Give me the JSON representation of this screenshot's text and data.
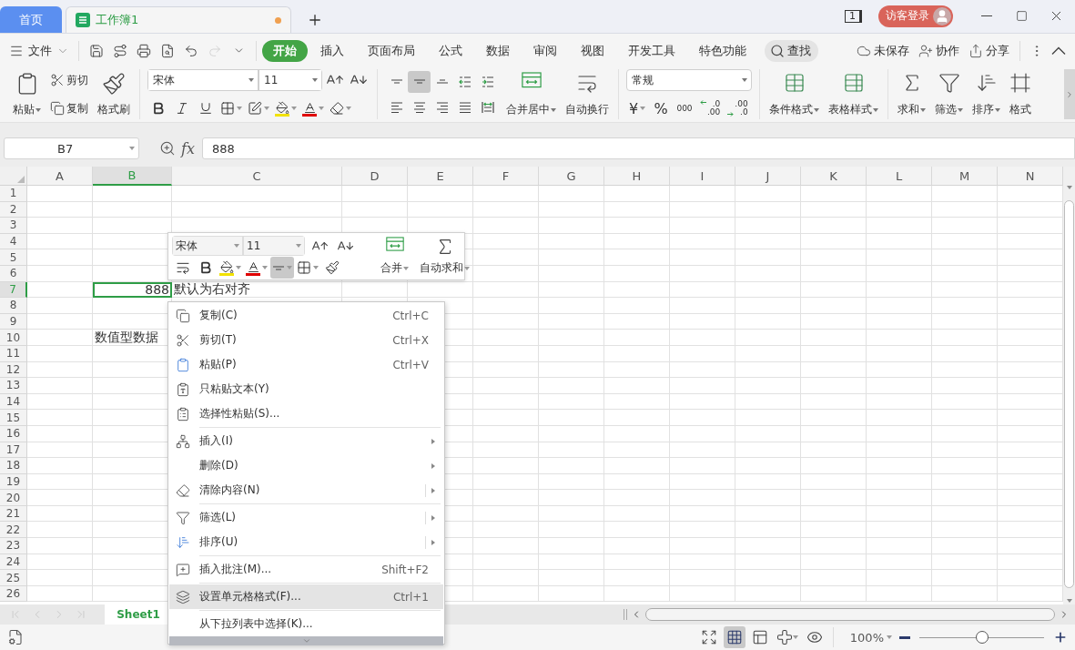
{
  "title_bar": {
    "tabs": [
      {
        "label": "首页",
        "kind": "home",
        "selected": false
      },
      {
        "label": "工作簿1",
        "kind": "sheet",
        "selected": true,
        "modified": true
      }
    ],
    "page_count": "1",
    "login": "访客登录"
  },
  "menu_bar": {
    "file": "文件",
    "quick_access": [
      {
        "kind": "save",
        "disabled": false
      },
      {
        "kind": "route",
        "disabled": false
      },
      {
        "kind": "print",
        "disabled": false
      },
      {
        "kind": "preview",
        "disabled": false
      },
      {
        "kind": "undo",
        "disabled": false
      },
      {
        "kind": "redo",
        "disabled": true
      },
      {
        "kind": "more",
        "disabled": false
      }
    ],
    "tabs": [
      {
        "label": "开始",
        "selected": true
      },
      {
        "label": "插入",
        "selected": false
      },
      {
        "label": "页面布局",
        "selected": false
      },
      {
        "label": "公式",
        "selected": false
      },
      {
        "label": "数据",
        "selected": false
      },
      {
        "label": "审阅",
        "selected": false
      },
      {
        "label": "视图",
        "selected": false
      },
      {
        "label": "开发工具",
        "selected": false
      },
      {
        "label": "特色功能",
        "selected": false
      }
    ],
    "search": "查找",
    "actions": [
      {
        "kind": "cloud",
        "label": "未保存"
      },
      {
        "kind": "collab",
        "label": "协作"
      },
      {
        "kind": "share",
        "label": "分享"
      }
    ]
  },
  "ribbon": {
    "paste": "粘贴",
    "cut": "剪切",
    "copy": "复制",
    "painter": "格式刷",
    "font": "宋体",
    "size": "11",
    "font_tools": [
      {
        "kind": "bold"
      },
      {
        "kind": "italic"
      },
      {
        "kind": "underline"
      },
      {
        "kind": "borders"
      },
      {
        "kind": "format"
      },
      {
        "kind": "fill"
      },
      {
        "kind": "color"
      },
      {
        "kind": "eraser"
      }
    ],
    "align_tools": [
      {
        "kind": "top",
        "selected": false
      },
      {
        "kind": "middle",
        "selected": true
      },
      {
        "kind": "bottom",
        "selected": false
      },
      {
        "kind": "outdent",
        "selected": false
      },
      {
        "kind": "indent",
        "selected": false
      },
      {
        "kind": "left",
        "selected": false
      },
      {
        "kind": "center",
        "selected": false
      },
      {
        "kind": "right",
        "selected": false
      },
      {
        "kind": "justify",
        "selected": false
      },
      {
        "kind": "distributed",
        "selected": false
      }
    ],
    "merge": "合并居中",
    "wrap": "自动换行",
    "number_format": "常规",
    "currency": "¥",
    "percent": "%",
    "thousands": "000",
    "decimal_tools": [
      {
        "kind": "increase",
        "top": ".0",
        "bottom": ".00"
      },
      {
        "kind": "decrease",
        "top": ".00",
        "bottom": ".0"
      }
    ],
    "styles": [
      {
        "kind": "conditional",
        "label": "条件格式"
      },
      {
        "kind": "table",
        "label": "表格样式"
      }
    ],
    "editing": [
      {
        "kind": "sum",
        "label": "求和"
      },
      {
        "kind": "filter",
        "label": "筛选"
      },
      {
        "kind": "sort",
        "label": "排序"
      },
      {
        "kind": "format",
        "label": "格式"
      }
    ]
  },
  "formula_bar": {
    "name_box": "B7",
    "fx": "fx",
    "value": "888"
  },
  "grid": {
    "columns": [
      {
        "label": "A",
        "selected": false
      },
      {
        "label": "B",
        "selected": true
      },
      {
        "label": "C",
        "selected": false
      },
      {
        "label": "D",
        "selected": false
      },
      {
        "label": "E",
        "selected": false
      },
      {
        "label": "F",
        "selected": false
      },
      {
        "label": "G",
        "selected": false
      },
      {
        "label": "H",
        "selected": false
      },
      {
        "label": "I",
        "selected": false
      },
      {
        "label": "J",
        "selected": false
      },
      {
        "label": "K",
        "selected": false
      },
      {
        "label": "L",
        "selected": false
      },
      {
        "label": "M",
        "selected": false
      },
      {
        "label": "N",
        "selected": false
      }
    ],
    "rows": [
      {
        "label": "1",
        "selected": false
      },
      {
        "label": "2",
        "selected": false
      },
      {
        "label": "3",
        "selected": false
      },
      {
        "label": "4",
        "selected": false
      },
      {
        "label": "5",
        "selected": false
      },
      {
        "label": "6",
        "selected": false
      },
      {
        "label": "7",
        "selected": true,
        "cells": [
          null,
          {
            "text": "888",
            "kind": "number",
            "selected": true
          },
          {
            "text": "默认为右对齐",
            "kind": "text",
            "selected": false
          }
        ]
      },
      {
        "label": "8",
        "selected": false
      },
      {
        "label": "9",
        "selected": false
      },
      {
        "label": "10",
        "selected": false,
        "cells": [
          null,
          {
            "text": "数值型数据",
            "kind": "text",
            "selected": false
          }
        ]
      },
      {
        "label": "11",
        "selected": false
      },
      {
        "label": "12",
        "selected": false
      },
      {
        "label": "13",
        "selected": false
      },
      {
        "label": "14",
        "selected": false
      },
      {
        "label": "15",
        "selected": false
      },
      {
        "label": "16",
        "selected": false
      },
      {
        "label": "17",
        "selected": false
      },
      {
        "label": "18",
        "selected": false
      },
      {
        "label": "19",
        "selected": false
      },
      {
        "label": "20",
        "selected": false
      },
      {
        "label": "21",
        "selected": false
      },
      {
        "label": "22",
        "selected": false
      },
      {
        "label": "23",
        "selected": false
      },
      {
        "label": "24",
        "selected": false
      },
      {
        "label": "25",
        "selected": false
      },
      {
        "label": "26",
        "selected": false
      }
    ]
  },
  "mini_toolbar": {
    "font": "宋体",
    "size": "11",
    "tools": [
      {
        "kind": "wrap",
        "selected": false
      },
      {
        "kind": "bold",
        "selected": false
      },
      {
        "kind": "fill",
        "selected": false
      },
      {
        "kind": "color",
        "selected": false
      },
      {
        "kind": "align",
        "selected": true
      },
      {
        "kind": "borders",
        "selected": false
      },
      {
        "kind": "painter",
        "selected": false
      }
    ],
    "merge": "合并",
    "autosum": "自动求和"
  },
  "context_menu": {
    "items": [
      {
        "kind": "copy",
        "label": "复制(C)",
        "shortcut": "Ctrl+C",
        "submenu": false,
        "selected": false
      },
      {
        "kind": "cut",
        "label": "剪切(T)",
        "shortcut": "Ctrl+X",
        "submenu": false,
        "selected": false
      },
      {
        "kind": "paste",
        "label": "粘贴(P)",
        "shortcut": "Ctrl+V",
        "submenu": false,
        "selected": false
      },
      {
        "kind": "paste_text",
        "label": "只粘贴文本(Y)",
        "submenu": false,
        "selected": false
      },
      {
        "kind": "paste_special",
        "label": "选择性粘贴(S)...",
        "submenu": false,
        "selected": false
      },
      {
        "kind": "separator"
      },
      {
        "kind": "insert",
        "label": "插入(I)",
        "submenu": true,
        "selected": false
      },
      {
        "kind": "plain",
        "label": "删除(D)",
        "submenu": true,
        "selected": false
      },
      {
        "kind": "clear",
        "label": "清除内容(N)",
        "submenu": true,
        "split": true,
        "selected": false
      },
      {
        "kind": "separator"
      },
      {
        "kind": "filter",
        "label": "筛选(L)",
        "submenu": true,
        "split": true,
        "selected": false
      },
      {
        "kind": "sort",
        "label": "排序(U)",
        "submenu": true,
        "split": true,
        "selected": false
      },
      {
        "kind": "separator"
      },
      {
        "kind": "comment",
        "label": "插入批注(M)...",
        "shortcut": "Shift+F2",
        "submenu": false,
        "selected": false
      },
      {
        "kind": "separator"
      },
      {
        "kind": "format_cells",
        "label": "设置单元格格式(F)...",
        "shortcut": "Ctrl+1",
        "submenu": false,
        "selected": true
      },
      {
        "kind": "separator"
      },
      {
        "kind": "plain",
        "label": "从下拉列表中选择(K)...",
        "submenu": false,
        "selected": false
      }
    ]
  },
  "sheet_tabs": [
    {
      "label": "Sheet1",
      "selected": true
    }
  ],
  "status_bar": {
    "views": [
      {
        "kind": "fullscreen",
        "selected": false
      },
      {
        "kind": "normal",
        "selected": true
      },
      {
        "kind": "page",
        "selected": false
      },
      {
        "kind": "split",
        "selected": false
      },
      {
        "kind": "eye",
        "selected": false
      }
    ],
    "zoom": "100%",
    "zoom_slider": {
      "level": 0.5
    }
  }
}
